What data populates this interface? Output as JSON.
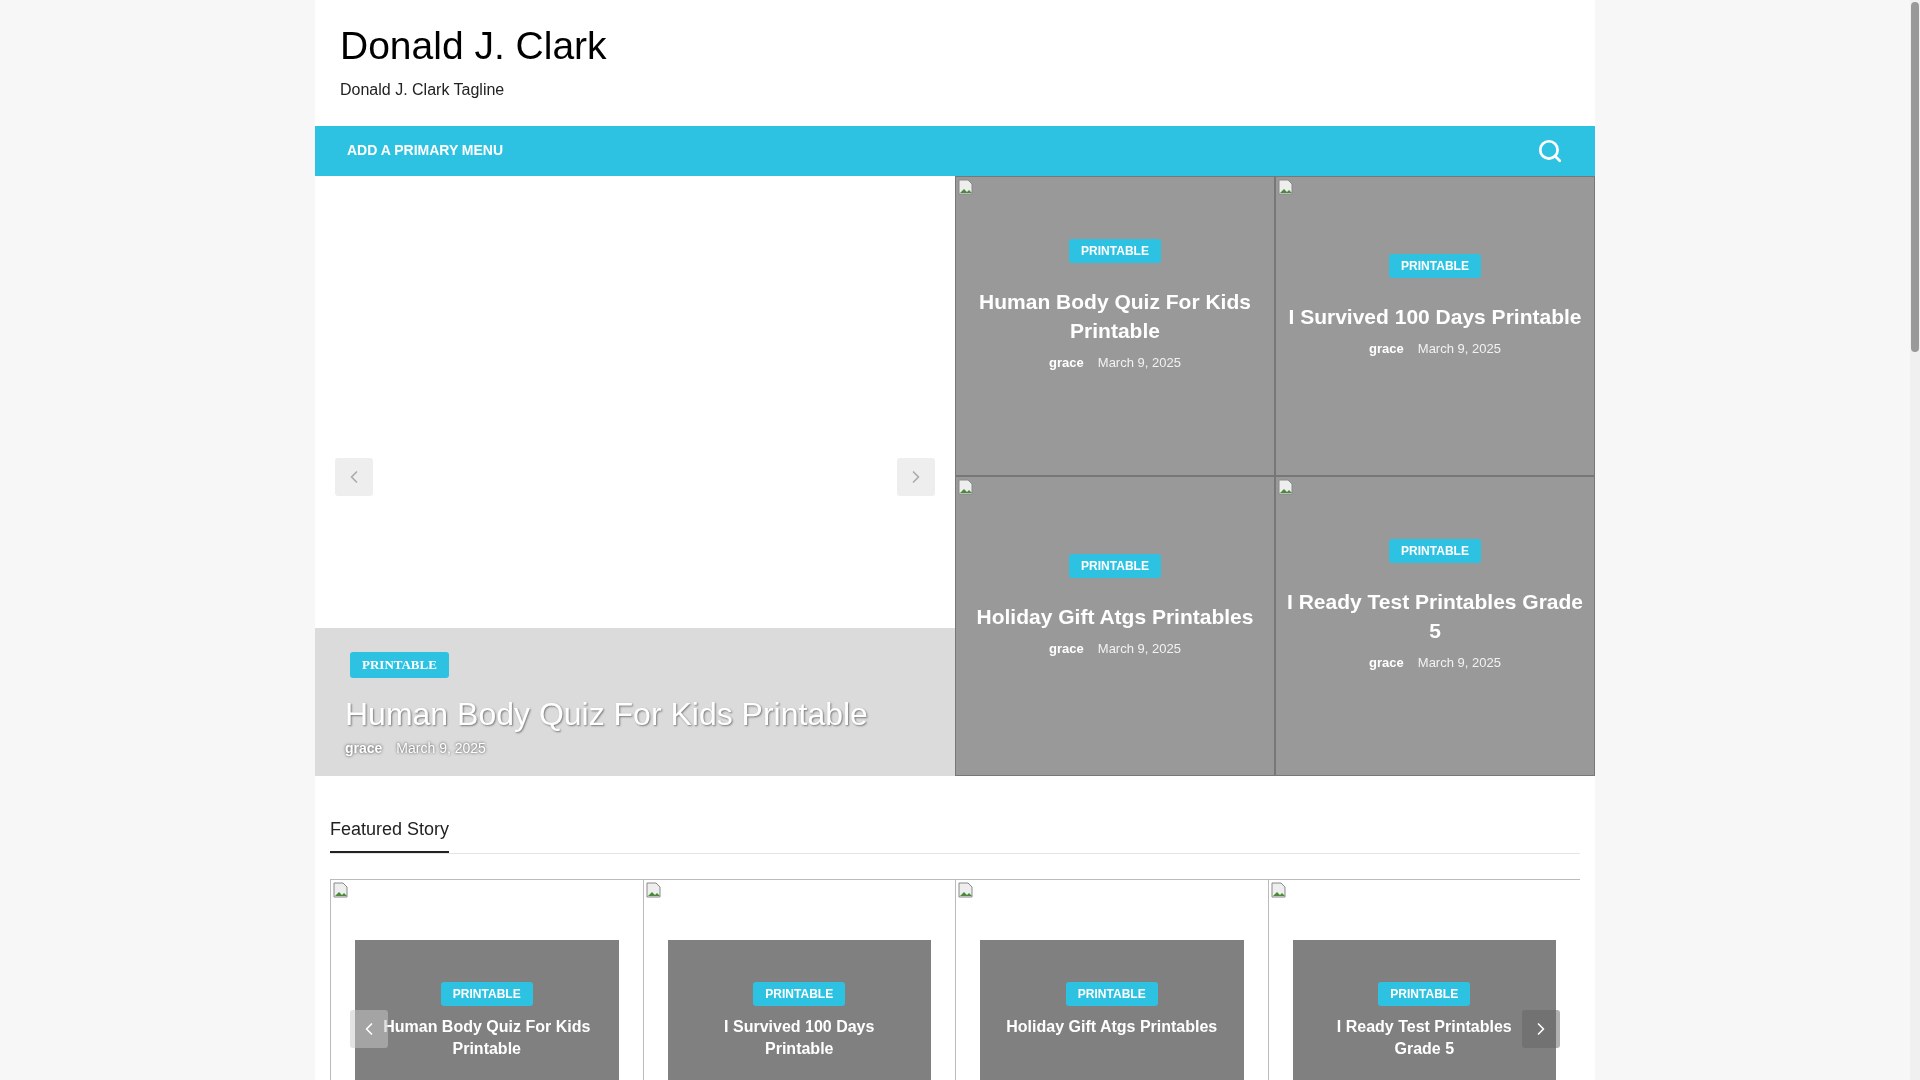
{
  "site": {
    "title": "Donald J. Clark",
    "tagline": "Donald J. Clark Tagline"
  },
  "nav": {
    "menu_link": "ADD A PRIMARY MENU"
  },
  "main_slide": {
    "category": "PRINTABLE",
    "title": "Human Body Quiz For Kids Printable",
    "author": "grace",
    "date": "March 9, 2025"
  },
  "grid_posts": [
    {
      "category": "PRINTABLE",
      "title": "Human Body Quiz For Kids Printable",
      "author": "grace",
      "date": "March 9, 2025"
    },
    {
      "category": "PRINTABLE",
      "title": "I Survived 100 Days Printable",
      "author": "grace",
      "date": "March 9, 2025"
    },
    {
      "category": "PRINTABLE",
      "title": "Holiday Gift Atgs Printables",
      "author": "grace",
      "date": "March 9, 2025"
    },
    {
      "category": "PRINTABLE",
      "title": "I Ready Test Printables Grade 5",
      "author": "grace",
      "date": "March 9, 2025"
    }
  ],
  "featured": {
    "heading": "Featured Story",
    "cards": [
      {
        "category": "PRINTABLE",
        "title": "Human Body Quiz For Kids Printable"
      },
      {
        "category": "PRINTABLE",
        "title": "I Survived 100 Days Printable"
      },
      {
        "category": "PRINTABLE",
        "title": "Holiday Gift Atgs Printables"
      },
      {
        "category": "PRINTABLE",
        "title": "I Ready Test Printables Grade 5"
      }
    ]
  }
}
